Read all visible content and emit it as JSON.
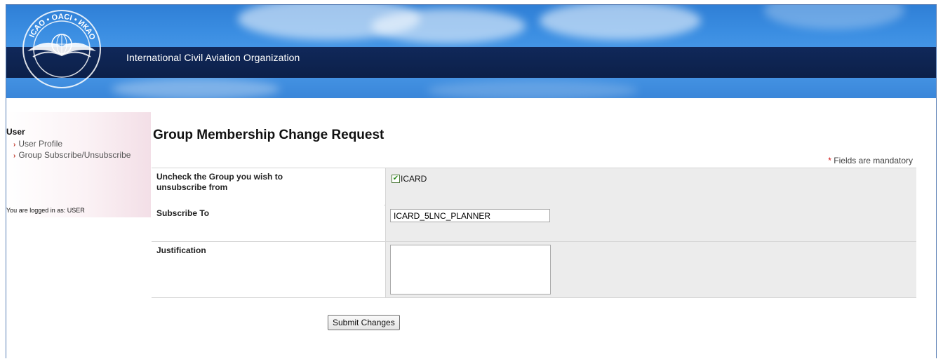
{
  "header": {
    "org_name": "International Civil Aviation Organization",
    "logo_text": "ICAO • OACI • ИКАО"
  },
  "sidebar": {
    "title": "User",
    "items": [
      {
        "label": "User Profile"
      },
      {
        "label": "Group Subscribe/Unsubscribe"
      }
    ],
    "logged_in": "You are logged in as: USER"
  },
  "main": {
    "title": "Group Membership Change Request",
    "mandatory_note": "Fields are mandatory",
    "mandatory_star": "*",
    "rows": {
      "unsubscribe": {
        "label": "Uncheck the Group you wish to unsubscribe from",
        "checkbox_label": "ICARD",
        "checked": true
      },
      "subscribe": {
        "label": "Subscribe To",
        "value": "ICARD_5LNC_PLANNER"
      },
      "justification": {
        "label": "Justification",
        "value": ""
      }
    },
    "submit_label": "Submit Changes"
  },
  "colors": {
    "banner_blue": "#3b8ee2",
    "title_bar": "#10285a",
    "bullet": "#c0392b",
    "required": "#d01010"
  }
}
